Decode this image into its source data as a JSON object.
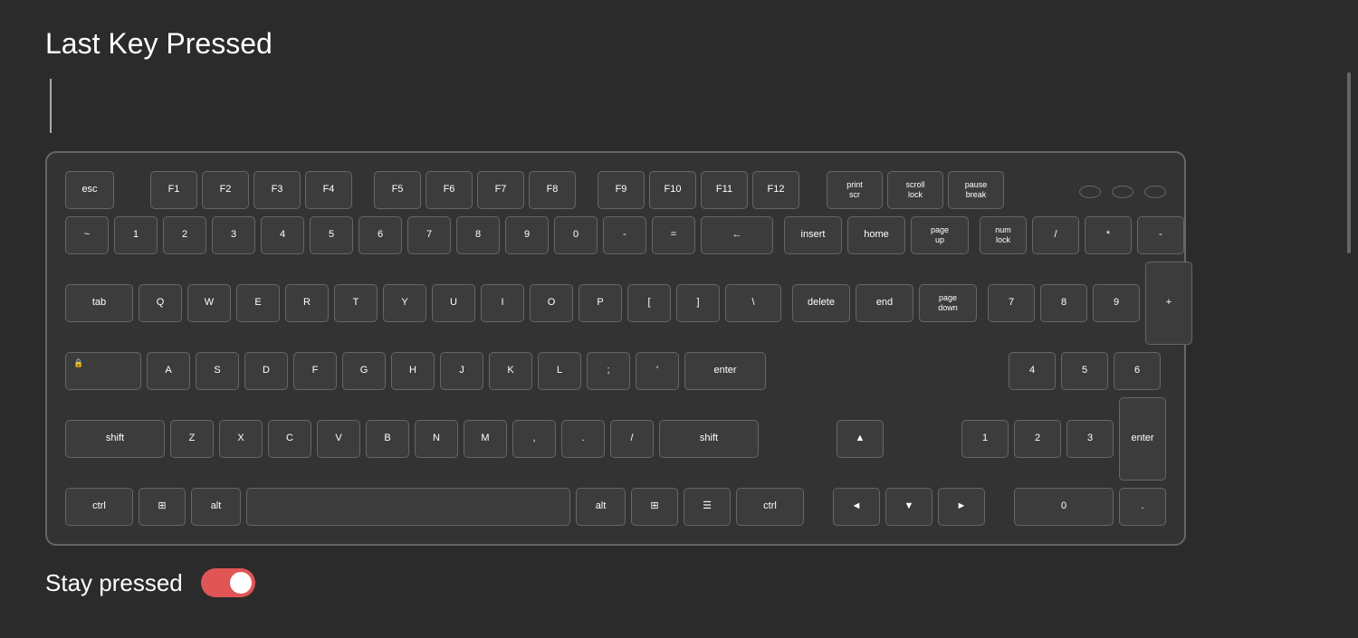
{
  "page": {
    "title": "Last Key Pressed",
    "last_key_display": ""
  },
  "footer": {
    "stay_pressed_label": "Stay pressed",
    "toggle_state": "on"
  },
  "keyboard": {
    "rows": {
      "fn": [
        "esc",
        "F1",
        "F2",
        "F3",
        "F4",
        "F5",
        "F6",
        "F7",
        "F8",
        "F9",
        "F10",
        "F11",
        "F12"
      ],
      "numbers": [
        "~",
        "1",
        "2",
        "3",
        "4",
        "5",
        "6",
        "7",
        "8",
        "9",
        "0",
        "-",
        "=",
        "←"
      ],
      "qwerty": [
        "tab",
        "Q",
        "W",
        "E",
        "R",
        "T",
        "Y",
        "U",
        "I",
        "O",
        "P",
        "[",
        "]",
        "\\"
      ],
      "asdf": [
        "caps",
        "A",
        "S",
        "D",
        "F",
        "G",
        "H",
        "J",
        "K",
        "L",
        ";",
        "'",
        "enter"
      ],
      "zxcv": [
        "shift",
        "Z",
        "X",
        "C",
        "V",
        "B",
        "N",
        "M",
        ",",
        ".",
        "/",
        "shift"
      ],
      "bottom": [
        "ctrl",
        "win",
        "alt",
        "space",
        "alt",
        "win",
        "menu",
        "ctrl"
      ]
    },
    "nav": {
      "top": [
        "print scr",
        "scroll lock",
        "pause break"
      ],
      "middle": [
        "insert",
        "home",
        "page up",
        "delete",
        "end",
        "page down"
      ],
      "arrows": [
        "▲",
        "◄",
        "▼",
        "►"
      ]
    },
    "numpad": {
      "top": [
        "num lock",
        "/",
        "*",
        "-"
      ],
      "row1": [
        "7",
        "8",
        "9"
      ],
      "row2": [
        "4",
        "5",
        "6"
      ],
      "row3": [
        "1",
        "2",
        "3"
      ],
      "bottom": [
        "0",
        "."
      ],
      "right_tall": [
        "+",
        "enter"
      ]
    }
  }
}
